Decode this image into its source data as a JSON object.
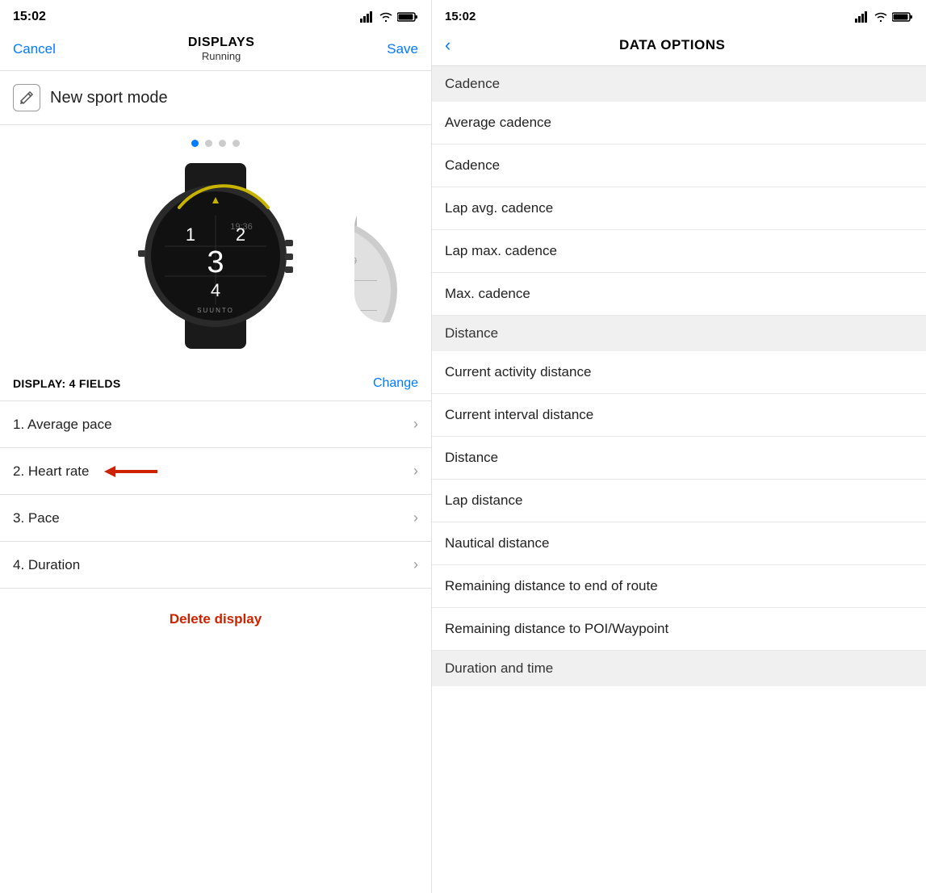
{
  "left": {
    "statusBar": {
      "time": "15:02",
      "timeArrow": "↗"
    },
    "navBar": {
      "cancel": "Cancel",
      "title": "DISPLAYS",
      "subtitle": "Running",
      "save": "Save"
    },
    "sportMode": {
      "label": "New sport mode"
    },
    "dots": [
      true,
      false,
      false,
      false
    ],
    "displayFields": {
      "title": "DISPLAY: 4 FIELDS",
      "changeLabel": "Change"
    },
    "fields": [
      {
        "label": "1. Average pace",
        "hasArrow": false
      },
      {
        "label": "2. Heart rate",
        "hasArrow": true
      },
      {
        "label": "3. Pace",
        "hasArrow": false
      },
      {
        "label": "4. Duration",
        "hasArrow": false
      }
    ],
    "deleteBtn": "Delete display"
  },
  "right": {
    "statusBar": {
      "time": "15:02",
      "timeArrow": "↗"
    },
    "navBar": {
      "back": "<",
      "title": "DATA OPTIONS"
    },
    "sections": [
      {
        "header": "Cadence",
        "items": [
          "Average cadence",
          "Cadence",
          "Lap avg. cadence",
          "Lap max. cadence",
          "Max. cadence"
        ]
      },
      {
        "header": "Distance",
        "items": [
          "Current activity distance",
          "Current interval distance",
          "Distance",
          "Lap distance",
          "Nautical distance",
          "Remaining distance to end of route",
          "Remaining distance to POI/Waypoint"
        ]
      },
      {
        "header": "Duration and time",
        "items": []
      }
    ]
  }
}
